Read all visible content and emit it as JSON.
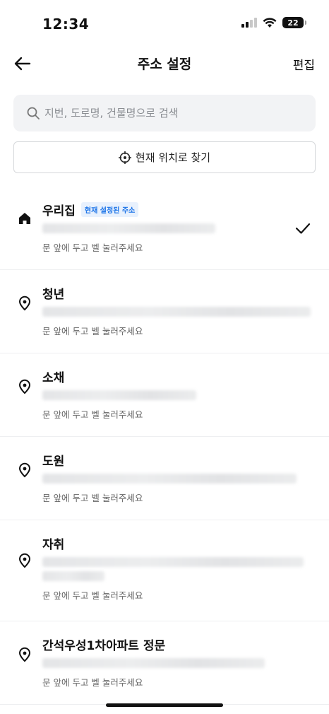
{
  "status_bar": {
    "time": "12:34",
    "battery": "22"
  },
  "header": {
    "title": "주소 설정",
    "edit_label": "편집"
  },
  "search": {
    "placeholder": "지번, 도로명, 건물명으로 검색"
  },
  "location_button": {
    "label": "현재 위치로 찾기"
  },
  "addresses": [
    {
      "name": "우리집",
      "badge": "현재 설정된 주소",
      "memo": "문 앞에 두고 벨 눌러주세요",
      "icon": "home-icon",
      "selected": true
    },
    {
      "name": "청년",
      "memo": "문 앞에 두고 벨 눌러주세요",
      "icon": "location-pin-icon"
    },
    {
      "name": "소채",
      "memo": "문 앞에 두고 벨 눌러주세요",
      "icon": "location-pin-icon"
    },
    {
      "name": "도원",
      "memo": "문 앞에 두고 벨 눌러주세요",
      "icon": "location-pin-icon"
    },
    {
      "name": "자취",
      "memo": "문 앞에 두고 벨 눌러주세요",
      "icon": "location-pin-icon"
    },
    {
      "name": "간석우성1차아파트 정문",
      "memo": "문 앞에 두고 벨 눌러주세요",
      "icon": "location-pin-icon"
    }
  ]
}
